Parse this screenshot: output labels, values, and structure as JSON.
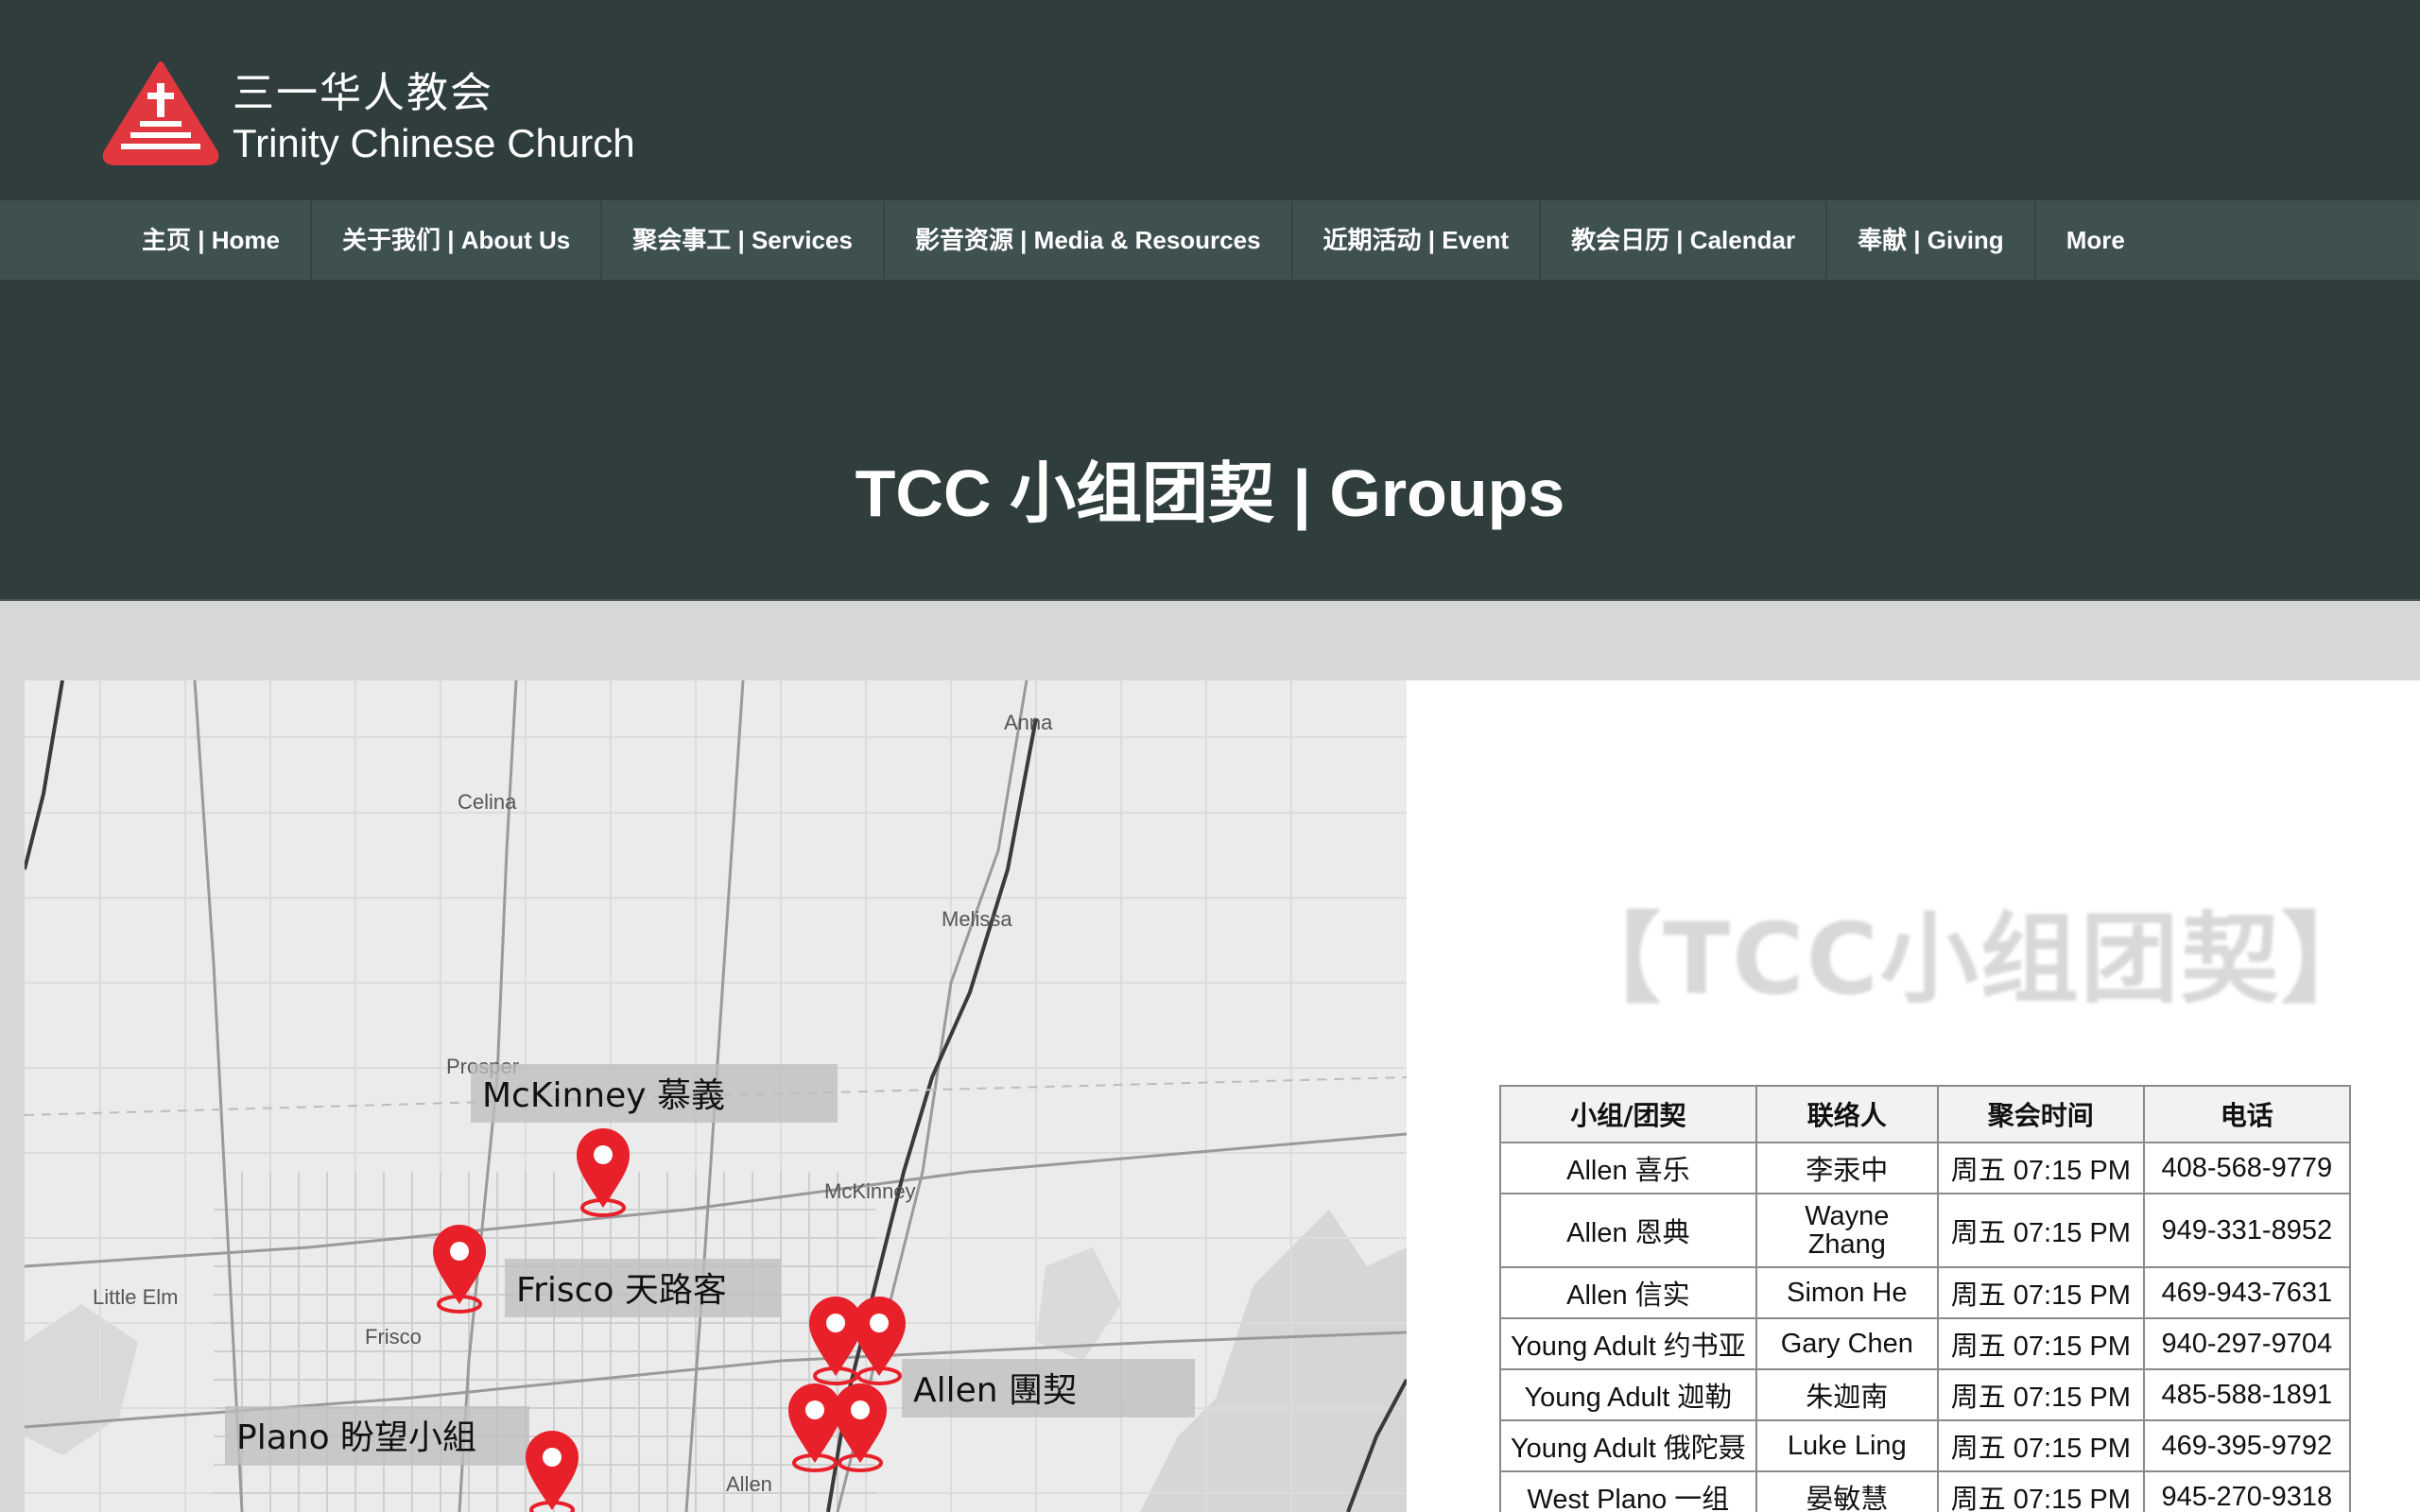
{
  "brand": {
    "name_cn": "三一华人教会",
    "name_en": "Trinity Chinese Church",
    "logo_color": "#e0383e"
  },
  "nav": {
    "items": [
      {
        "label": "主页 | Home"
      },
      {
        "label": "关于我们 | About Us"
      },
      {
        "label": "聚会事工 | Services"
      },
      {
        "label": "影音资源 | Media & Resources"
      },
      {
        "label": "近期活动 | Event"
      },
      {
        "label": "教会日历 | Calendar"
      },
      {
        "label": "奉献 | Giving"
      },
      {
        "label": "More"
      }
    ]
  },
  "hero": {
    "title": "TCC 小组团契 | Groups"
  },
  "map": {
    "towns": {
      "anna": "Anna",
      "celina": "Celina",
      "melissa": "Melissa",
      "prosper": "Prosper",
      "mckinney": "McKinney",
      "little_elm": "Little Elm",
      "frisco": "Frisco",
      "allen": "Allen"
    },
    "groups": {
      "mckinney": "McKinney 慕義",
      "frisco": "Frisco 天路客",
      "allen": "Allen 團契",
      "plano": "Plano 盼望小組"
    },
    "pin_color": "#e8202a"
  },
  "groups": {
    "heading": "【TCC小组团契】",
    "columns": [
      "小组/团契",
      "联络人",
      "聚会时间",
      "电话"
    ],
    "rows": [
      [
        "Allen 喜乐",
        "李汞中",
        "周五  07:15 PM",
        "408-568-9779"
      ],
      [
        "Allen 恩典",
        "Wayne Zhang",
        "周五  07:15 PM",
        "949-331-8952"
      ],
      [
        "Allen 信实",
        "Simon He",
        "周五  07:15 PM",
        "469-943-7631"
      ],
      [
        "Young Adult 约书亚",
        "Gary Chen",
        "周五  07:15 PM",
        "940-297-9704"
      ],
      [
        "Young Adult 迦勒",
        "朱迦南",
        "周五  07:15 PM",
        "485-588-1891"
      ],
      [
        "Young Adult 俄陀聂",
        "Luke Ling",
        "周五  07:15 PM",
        "469-395-9792"
      ],
      [
        "West Plano 一组",
        "晏敏慧",
        "周五  07:15 PM",
        "945-270-9318"
      ]
    ]
  }
}
